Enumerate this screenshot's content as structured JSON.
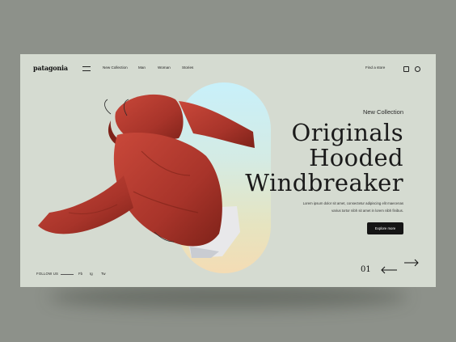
{
  "nav": {
    "logo": "patagonia",
    "links": [
      "New Collection",
      "Man",
      "Woman",
      "Stories"
    ],
    "find_store": "Find a store"
  },
  "hero": {
    "collection_tag": "New Collection",
    "title_lines": [
      "Originals",
      "Hooded",
      "Windbreaker"
    ],
    "description_lines": [
      "Lorem ipsum dolor sit amet, consectetur adipiscing elit maecenas",
      "varius tortor nibh sit amet in lorem nibh finibus."
    ],
    "cta_label": "Explore more",
    "slide_number": "01"
  },
  "footer": {
    "follow_label": "FOLLOW US",
    "social": [
      "Fb",
      "Ig",
      "Tw"
    ]
  },
  "colors": {
    "background": "#8d918a",
    "panel": "#d5dbd1",
    "jacket": "#b03a2e",
    "button": "#151515"
  },
  "icons": [
    "menu-icon",
    "bag-icon",
    "user-icon",
    "arrow-left-icon",
    "arrow-right-icon"
  ]
}
